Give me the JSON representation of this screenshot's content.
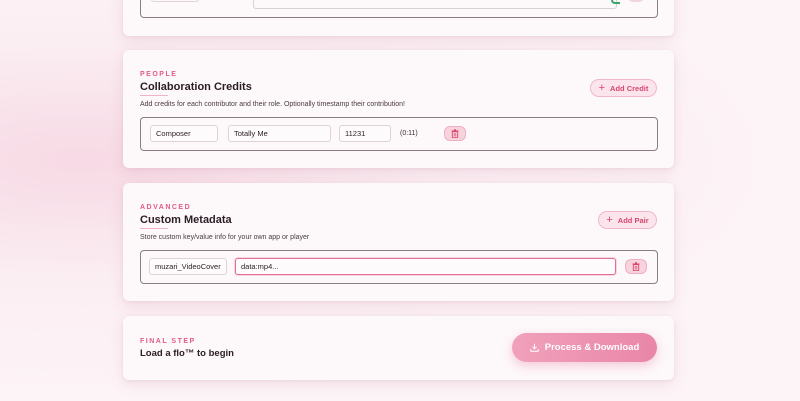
{
  "people": {
    "eyebrow": "PEOPLE",
    "title": "Collaboration Credits",
    "description": "Add credits for each contributor and their role. Optionally timestamp their contribution!",
    "add_button": "Add Credit",
    "credit": {
      "role": "Composer",
      "name": "Totally Me",
      "time": "11231",
      "time_display": "(0:11)"
    }
  },
  "advanced": {
    "eyebrow": "ADVANCED",
    "title": "Custom Metadata",
    "description": "Store custom key/value info for your own app or player",
    "add_button": "Add Pair",
    "pair": {
      "key": "muzari_VideoCover",
      "value": "data:mp4..."
    }
  },
  "final": {
    "eyebrow": "FINAL STEP",
    "title": "Load a flo™ to begin",
    "process_button": "Process & Download"
  },
  "colors": {
    "accent": "#e05c86",
    "button_gradient_start": "#f0a1bb",
    "button_gradient_end": "#ea86a7",
    "trash_bg": "#f8d2dc"
  },
  "icons": [
    "plus-icon",
    "trash-icon",
    "download-icon",
    "check-mark-icon"
  ]
}
